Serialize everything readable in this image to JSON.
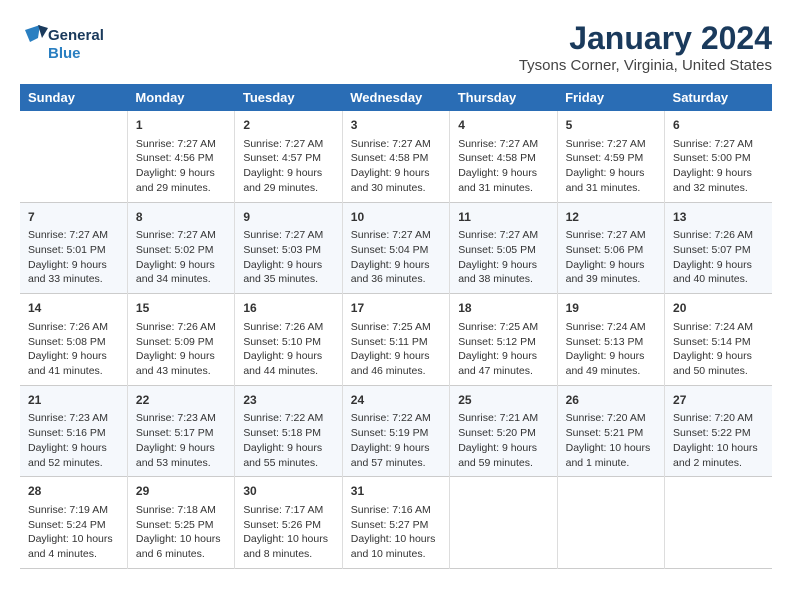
{
  "header": {
    "logo_line1": "General",
    "logo_line2": "Blue",
    "month": "January 2024",
    "location": "Tysons Corner, Virginia, United States"
  },
  "days_of_week": [
    "Sunday",
    "Monday",
    "Tuesday",
    "Wednesday",
    "Thursday",
    "Friday",
    "Saturday"
  ],
  "weeks": [
    [
      {
        "day": "",
        "info": ""
      },
      {
        "day": "1",
        "info": "Sunrise: 7:27 AM\nSunset: 4:56 PM\nDaylight: 9 hours\nand 29 minutes."
      },
      {
        "day": "2",
        "info": "Sunrise: 7:27 AM\nSunset: 4:57 PM\nDaylight: 9 hours\nand 29 minutes."
      },
      {
        "day": "3",
        "info": "Sunrise: 7:27 AM\nSunset: 4:58 PM\nDaylight: 9 hours\nand 30 minutes."
      },
      {
        "day": "4",
        "info": "Sunrise: 7:27 AM\nSunset: 4:58 PM\nDaylight: 9 hours\nand 31 minutes."
      },
      {
        "day": "5",
        "info": "Sunrise: 7:27 AM\nSunset: 4:59 PM\nDaylight: 9 hours\nand 31 minutes."
      },
      {
        "day": "6",
        "info": "Sunrise: 7:27 AM\nSunset: 5:00 PM\nDaylight: 9 hours\nand 32 minutes."
      }
    ],
    [
      {
        "day": "7",
        "info": "Sunrise: 7:27 AM\nSunset: 5:01 PM\nDaylight: 9 hours\nand 33 minutes."
      },
      {
        "day": "8",
        "info": "Sunrise: 7:27 AM\nSunset: 5:02 PM\nDaylight: 9 hours\nand 34 minutes."
      },
      {
        "day": "9",
        "info": "Sunrise: 7:27 AM\nSunset: 5:03 PM\nDaylight: 9 hours\nand 35 minutes."
      },
      {
        "day": "10",
        "info": "Sunrise: 7:27 AM\nSunset: 5:04 PM\nDaylight: 9 hours\nand 36 minutes."
      },
      {
        "day": "11",
        "info": "Sunrise: 7:27 AM\nSunset: 5:05 PM\nDaylight: 9 hours\nand 38 minutes."
      },
      {
        "day": "12",
        "info": "Sunrise: 7:27 AM\nSunset: 5:06 PM\nDaylight: 9 hours\nand 39 minutes."
      },
      {
        "day": "13",
        "info": "Sunrise: 7:26 AM\nSunset: 5:07 PM\nDaylight: 9 hours\nand 40 minutes."
      }
    ],
    [
      {
        "day": "14",
        "info": "Sunrise: 7:26 AM\nSunset: 5:08 PM\nDaylight: 9 hours\nand 41 minutes."
      },
      {
        "day": "15",
        "info": "Sunrise: 7:26 AM\nSunset: 5:09 PM\nDaylight: 9 hours\nand 43 minutes."
      },
      {
        "day": "16",
        "info": "Sunrise: 7:26 AM\nSunset: 5:10 PM\nDaylight: 9 hours\nand 44 minutes."
      },
      {
        "day": "17",
        "info": "Sunrise: 7:25 AM\nSunset: 5:11 PM\nDaylight: 9 hours\nand 46 minutes."
      },
      {
        "day": "18",
        "info": "Sunrise: 7:25 AM\nSunset: 5:12 PM\nDaylight: 9 hours\nand 47 minutes."
      },
      {
        "day": "19",
        "info": "Sunrise: 7:24 AM\nSunset: 5:13 PM\nDaylight: 9 hours\nand 49 minutes."
      },
      {
        "day": "20",
        "info": "Sunrise: 7:24 AM\nSunset: 5:14 PM\nDaylight: 9 hours\nand 50 minutes."
      }
    ],
    [
      {
        "day": "21",
        "info": "Sunrise: 7:23 AM\nSunset: 5:16 PM\nDaylight: 9 hours\nand 52 minutes."
      },
      {
        "day": "22",
        "info": "Sunrise: 7:23 AM\nSunset: 5:17 PM\nDaylight: 9 hours\nand 53 minutes."
      },
      {
        "day": "23",
        "info": "Sunrise: 7:22 AM\nSunset: 5:18 PM\nDaylight: 9 hours\nand 55 minutes."
      },
      {
        "day": "24",
        "info": "Sunrise: 7:22 AM\nSunset: 5:19 PM\nDaylight: 9 hours\nand 57 minutes."
      },
      {
        "day": "25",
        "info": "Sunrise: 7:21 AM\nSunset: 5:20 PM\nDaylight: 9 hours\nand 59 minutes."
      },
      {
        "day": "26",
        "info": "Sunrise: 7:20 AM\nSunset: 5:21 PM\nDaylight: 10 hours\nand 1 minute."
      },
      {
        "day": "27",
        "info": "Sunrise: 7:20 AM\nSunset: 5:22 PM\nDaylight: 10 hours\nand 2 minutes."
      }
    ],
    [
      {
        "day": "28",
        "info": "Sunrise: 7:19 AM\nSunset: 5:24 PM\nDaylight: 10 hours\nand 4 minutes."
      },
      {
        "day": "29",
        "info": "Sunrise: 7:18 AM\nSunset: 5:25 PM\nDaylight: 10 hours\nand 6 minutes."
      },
      {
        "day": "30",
        "info": "Sunrise: 7:17 AM\nSunset: 5:26 PM\nDaylight: 10 hours\nand 8 minutes."
      },
      {
        "day": "31",
        "info": "Sunrise: 7:16 AM\nSunset: 5:27 PM\nDaylight: 10 hours\nand 10 minutes."
      },
      {
        "day": "",
        "info": ""
      },
      {
        "day": "",
        "info": ""
      },
      {
        "day": "",
        "info": ""
      }
    ]
  ]
}
